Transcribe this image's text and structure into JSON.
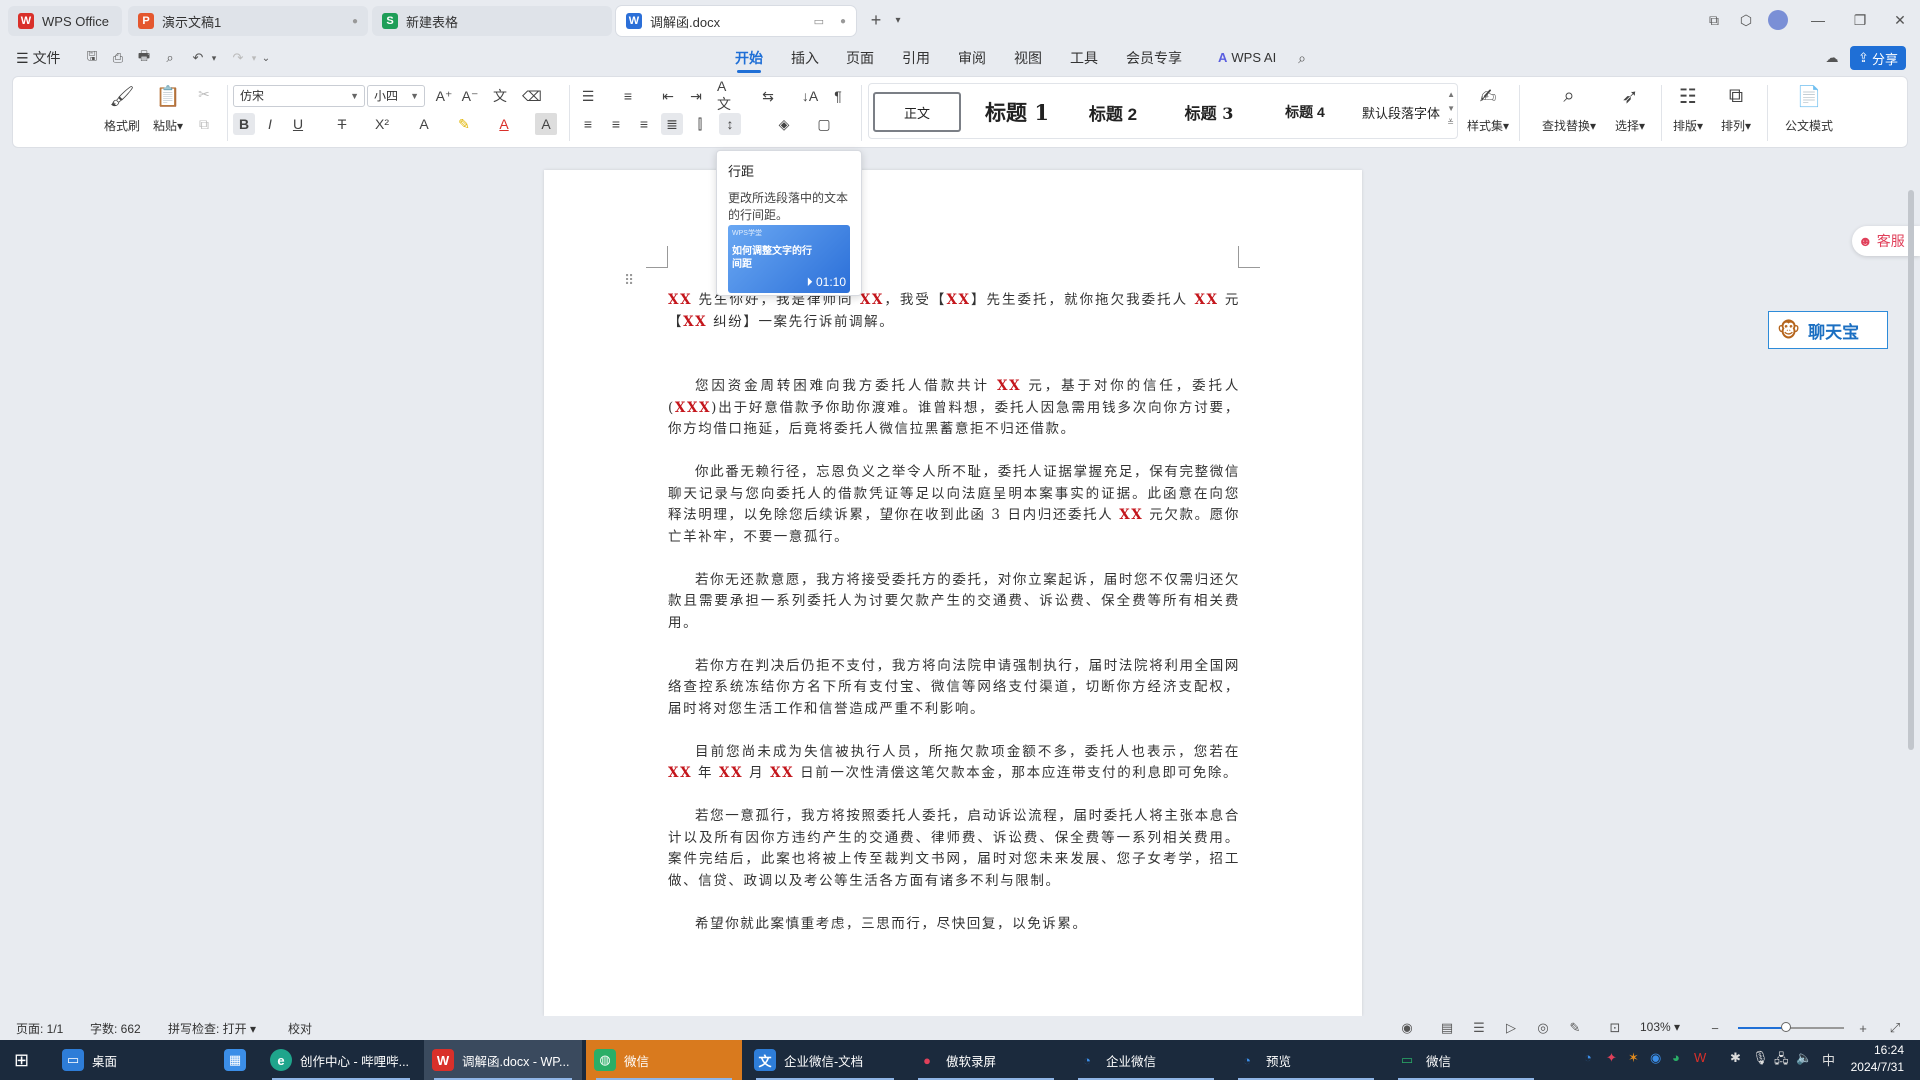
{
  "tabs": [
    {
      "label": "WPS Office",
      "icon": "wps-logo-icon"
    },
    {
      "label": "演示文稿1",
      "icon": "presentation-icon"
    },
    {
      "label": "新建表格",
      "icon": "spreadsheet-icon"
    },
    {
      "label": "调解函.docx",
      "icon": "writer-doc-icon"
    }
  ],
  "menu": {
    "file": "文件",
    "tabs": [
      "开始",
      "插入",
      "页面",
      "引用",
      "审阅",
      "视图",
      "工具",
      "会员专享"
    ],
    "active_tab": "开始",
    "wps_ai": "WPS AI",
    "share": "分享"
  },
  "ribbon": {
    "format_painter": "格式刷",
    "paste": "粘贴",
    "font_name": "仿宋",
    "font_size": "小四",
    "styles": [
      "正文",
      "标题 1",
      "标题 2",
      "标题 3",
      "标题 4",
      "默认段落字体"
    ],
    "style_set": "样式集",
    "find_replace": "查找替换",
    "select": "选择",
    "typeset": "排版",
    "arrange": "排列",
    "official_doc": "公文模式"
  },
  "tooltip": {
    "title": "行距",
    "description": "更改所选段落中的文本的行间距。",
    "video_caption": "如何调整文字的行间距",
    "video_tag": "WPS学堂",
    "video_duration": "01:10"
  },
  "document": {
    "paragraphs": [
      [
        {
          "t": "XX",
          "red": true
        },
        {
          "t": " 先生你好，我是律师同 "
        },
        {
          "t": "XX",
          "red": true
        },
        {
          "t": "，我受【"
        },
        {
          "t": "XX",
          "red": true
        },
        {
          "t": "】先生委托，就你拖欠我委托人 "
        },
        {
          "t": "XX",
          "red": true
        },
        {
          "t": " 元【"
        },
        {
          "t": "XX",
          "red": true
        },
        {
          "t": " 纠纷】一案先行诉前调解。"
        }
      ],
      [
        {
          "t": "您因资金周转困难向我方委托人借款共计 "
        },
        {
          "t": "XX",
          "red": true
        },
        {
          "t": " 元，基于对你的信任，委托人("
        },
        {
          "t": "XXX",
          "red": true
        },
        {
          "t": ")出于好意借款予你助你渡难。谁曾料想，委托人因急需用钱多次向你方讨要，你方均借口拖延，后竟将委托人微信拉黑蓄意拒不归还借款。"
        }
      ],
      [
        {
          "t": "你此番无赖行径，忘恩负义之举令人所不耻，委托人证据掌握充足，保有完整微信聊天记录与您向委托人的借款凭证等足以向法庭呈明本案事实的证据。此函意在向您释法明理，以免除您后续诉累，望你在收到此函 3 日内归还委托人 "
        },
        {
          "t": "XX",
          "red": true
        },
        {
          "t": " 元欠款。愿你亡羊补牢，不要一意孤行。"
        }
      ],
      [
        {
          "t": "若你无还款意愿，我方将接受委托方的委托，对你立案起诉，届时您不仅需归还欠款且需要承担一系列委托人为讨要欠款产生的交通费、诉讼费、保全费等所有相关费用。"
        }
      ],
      [
        {
          "t": "若你方在判决后仍拒不支付，我方将向法院申请强制执行，届时法院将利用全国网络查控系统冻结你方名下所有支付宝、微信等网络支付渠道，切断你方经济支配权，届时将对您生活工作和信誉造成严重不利影响。"
        }
      ],
      [
        {
          "t": "目前您尚未成为失信被执行人员，所拖欠款项金额不多，委托人也表示，您若在 "
        },
        {
          "t": "XX",
          "red": true
        },
        {
          "t": " 年 "
        },
        {
          "t": "XX",
          "red": true
        },
        {
          "t": " 月 "
        },
        {
          "t": "XX",
          "red": true
        },
        {
          "t": " 日前一次性清偿这笔欠款本金，那本应连带支付的利息即可免除。"
        }
      ],
      [
        {
          "t": "若您一意孤行，我方将按照委托人委托，启动诉讼流程，届时委托人将主张本息合计以及所有因你方违约产生的交通费、律师费、诉讼费、保全费等一系列相关费用。案件完结后，此案也将被上传至裁判文书网，届时对您未来发展、您子女考学，招工做、信贷、政调以及考公等生活各方面有诸多不利与限制。"
        }
      ],
      [
        {
          "t": "希望你就此案慎重考虑，三思而行，尽快回复，以免诉累。"
        }
      ]
    ]
  },
  "side": {
    "kefu": "客服",
    "chatbao": "聊天宝"
  },
  "status": {
    "page": "页面: 1/1",
    "words": "字数: 662",
    "spellcheck": "拼写检查: 打开",
    "proofread": "校对",
    "zoom": "103%",
    "zoom_fraction": 0.45
  },
  "taskbar": {
    "items": [
      "桌面",
      "创作中心 - 哔哩哔...",
      "调解函.docx - WP...",
      "微信",
      "企业微信-文档",
      "傲软录屏",
      "企业微信",
      "预览",
      "微信"
    ],
    "time": "16:24",
    "date": "2024/7/31",
    "ime": "中"
  },
  "colors": {
    "accent": "#1f6fd6",
    "highlight": "#c4161c",
    "taskbar": "#1b2a3d"
  }
}
